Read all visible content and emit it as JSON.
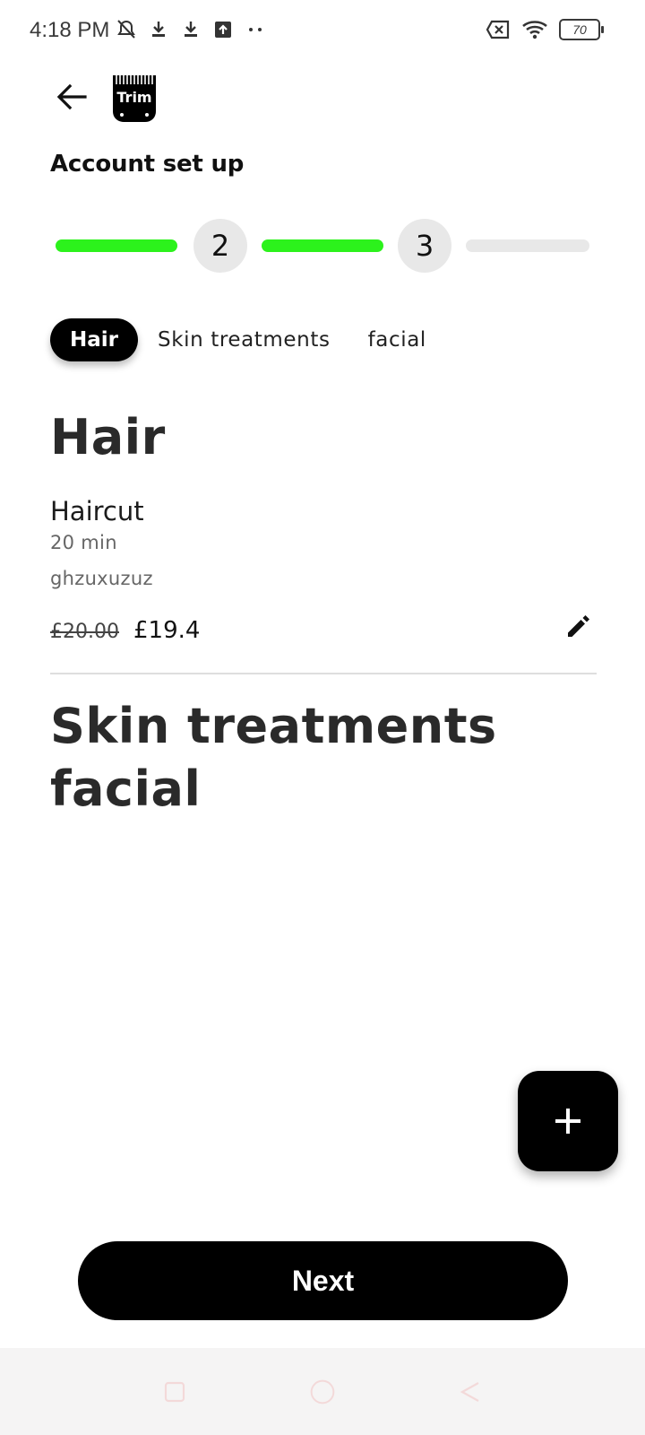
{
  "status_bar": {
    "time": "4:18 PM",
    "battery": "70",
    "left_icons": [
      "mute-icon",
      "download-icon",
      "download-icon",
      "upload-icon",
      "more-dots-icon"
    ],
    "right_icons": [
      "sim-off-icon",
      "wifi-icon",
      "battery-icon"
    ]
  },
  "header": {
    "back_icon": "arrow-left-icon",
    "logo_text": "Trim",
    "title": "Account set up"
  },
  "stepper": {
    "steps": [
      "2",
      "3"
    ],
    "progress_segments": [
      1,
      1,
      0
    ],
    "active_color": "#2cf21c",
    "inactive_color": "#e8e8e8"
  },
  "tabs": [
    {
      "label": "Hair",
      "active": true
    },
    {
      "label": "Skin treatments",
      "active": false
    },
    {
      "label": "facial",
      "active": false
    }
  ],
  "sections": [
    {
      "title": "Hair",
      "services": [
        {
          "name": "Haircut",
          "duration": "20 min",
          "description": "ghzuxuzuz",
          "original_price": "£20.00",
          "price": "£19.4"
        }
      ]
    },
    {
      "title": "Skin treatments",
      "services": []
    },
    {
      "title": "facial",
      "services": []
    }
  ],
  "fab": {
    "icon": "plus-icon"
  },
  "next_button": {
    "label": "Next"
  },
  "nav_bar": {
    "icons": [
      "recents-icon",
      "home-icon",
      "back-triangle-icon"
    ]
  }
}
